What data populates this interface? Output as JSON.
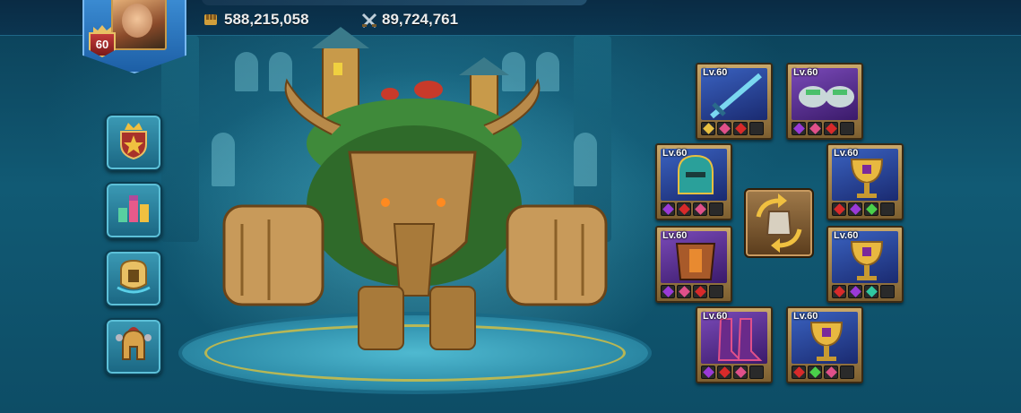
{
  "header": {
    "power_value": "588,215,058",
    "kills_value": "89,724,761",
    "power_icon": "fist-icon",
    "kills_icon": "crossed-swords-icon"
  },
  "player": {
    "level": "60"
  },
  "side_menu": [
    {
      "icon": "crown-star-shield-icon"
    },
    {
      "icon": "bar-chart-blocks-icon"
    },
    {
      "icon": "armor-swap-icon"
    },
    {
      "icon": "spartan-helmet-icon"
    }
  ],
  "equipment": {
    "top_left": {
      "level": "Lv.60",
      "item": "sword",
      "gems": [
        "gold",
        "pink",
        "red",
        "empty"
      ]
    },
    "top_right": {
      "level": "Lv.60",
      "item": "gauntlets",
      "gems": [
        "purple",
        "pink",
        "red",
        "empty"
      ]
    },
    "mid_left_1": {
      "level": "Lv.60",
      "item": "helmet",
      "gems": [
        "purple",
        "red",
        "pink",
        "empty"
      ]
    },
    "mid_right_1": {
      "level": "Lv.60",
      "item": "chalice",
      "gems": [
        "red",
        "purple",
        "green",
        "empty"
      ]
    },
    "mid_left_2": {
      "level": "Lv.60",
      "item": "armor",
      "gems": [
        "purple",
        "pink",
        "red",
        "empty"
      ]
    },
    "mid_right_2": {
      "level": "Lv.60",
      "item": "chalice",
      "gems": [
        "red",
        "purple",
        "teal",
        "empty"
      ]
    },
    "bottom_left": {
      "level": "Lv.60",
      "item": "boots",
      "gems": [
        "purple",
        "red",
        "pink",
        "empty"
      ]
    },
    "bottom_right": {
      "level": "Lv.60",
      "item": "chalice",
      "gems": [
        "red",
        "green",
        "pink",
        "empty"
      ]
    }
  },
  "colors": {
    "gold": "#e8c040",
    "pink": "#e0508a",
    "red": "#d82a2a",
    "purple": "#9a3ad8",
    "green": "#4ad04a",
    "teal": "#30c8a0"
  }
}
